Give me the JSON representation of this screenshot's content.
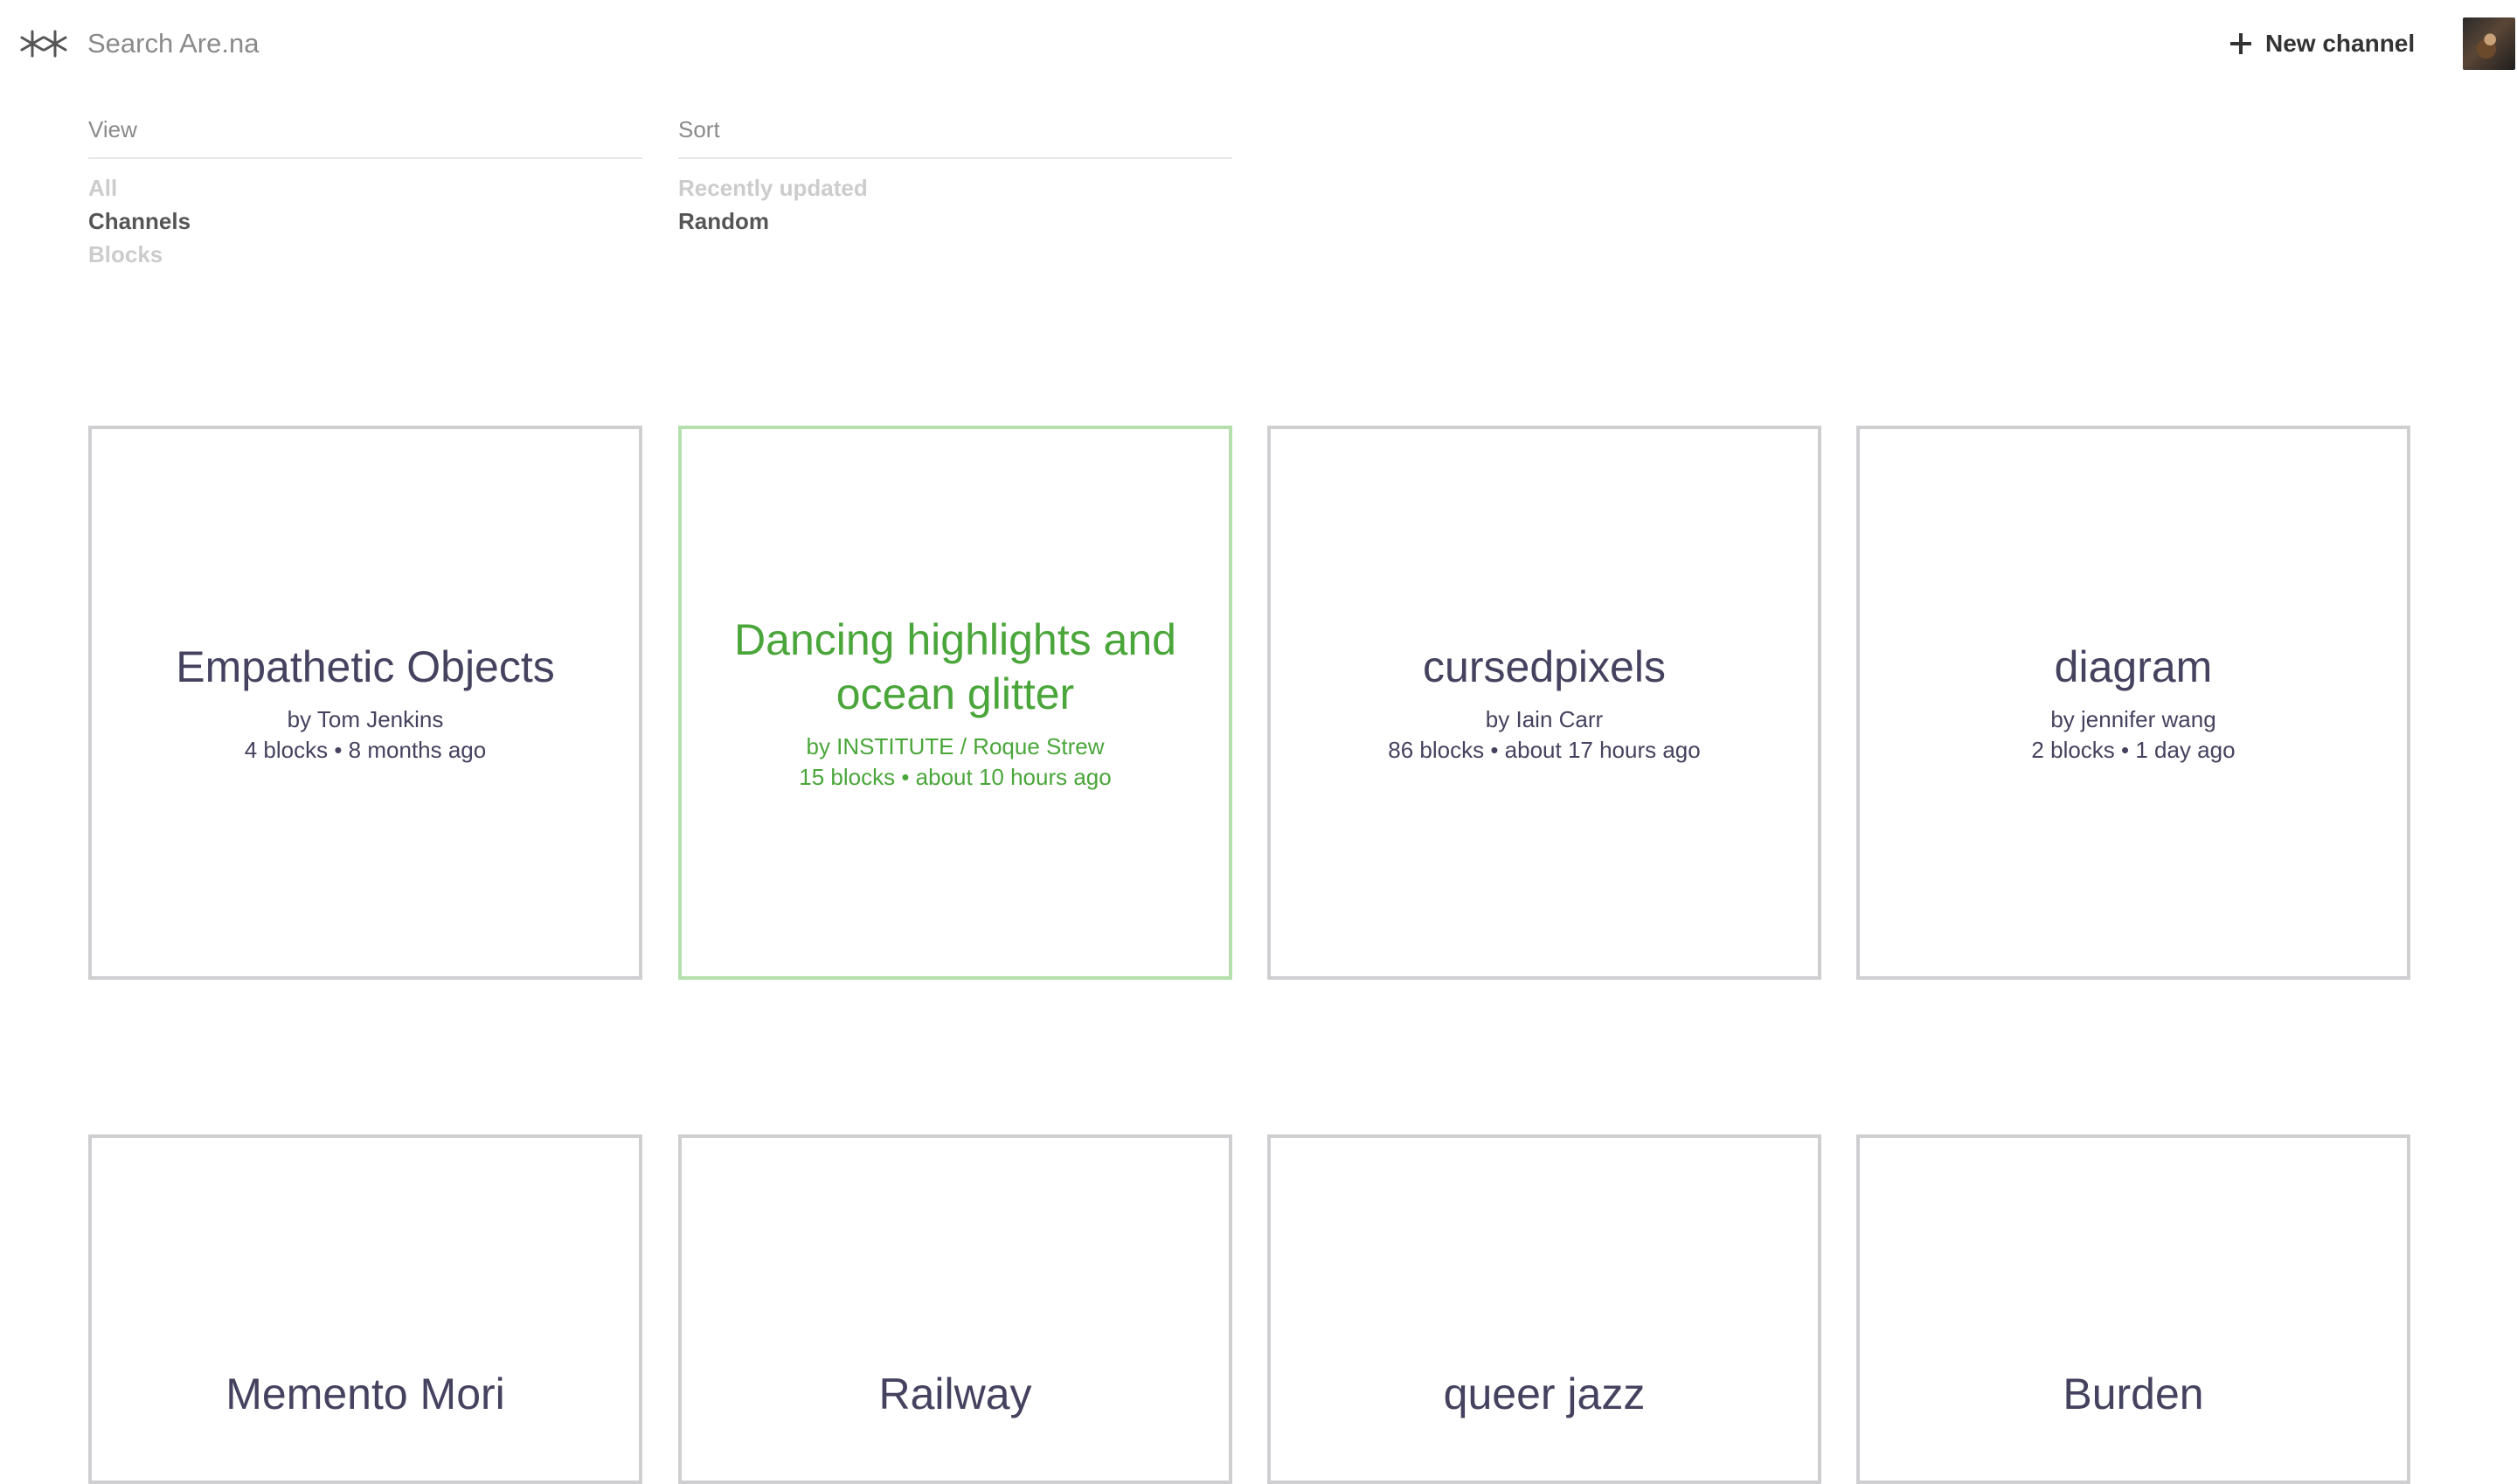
{
  "header": {
    "search_placeholder": "Search Are.na",
    "new_channel_label": "New channel"
  },
  "filters": {
    "view": {
      "heading": "View",
      "options": [
        {
          "label": "All",
          "active": false
        },
        {
          "label": "Channels",
          "active": true
        },
        {
          "label": "Blocks",
          "active": false
        }
      ]
    },
    "sort": {
      "heading": "Sort",
      "options": [
        {
          "label": "Recently updated",
          "active": false
        },
        {
          "label": "Random",
          "active": true
        }
      ]
    }
  },
  "colors": {
    "text_dark": "#44425e",
    "highlight_green": "#4aa63a",
    "highlight_border": "#b5e0ae",
    "card_border": "#cfcfd2"
  },
  "channels": [
    {
      "title": "Empathetic Objects",
      "author": "by Tom Jenkins",
      "meta": "4 blocks • 8 months ago"
    },
    {
      "title": "Dancing highlights and ocean glitter",
      "author": "by INSTITUTE / Roque Strew",
      "meta": "15 blocks • about 10 hours ago"
    },
    {
      "title": "cursedpixels",
      "author": "by Iain Carr",
      "meta": "86 blocks • about 17 hours ago"
    },
    {
      "title": "diagram",
      "author": "by jennifer wang",
      "meta": "2 blocks • 1 day ago"
    },
    {
      "title": "Memento Mori"
    },
    {
      "title": "Railway"
    },
    {
      "title": "queer jazz"
    },
    {
      "title": "Burden"
    }
  ]
}
